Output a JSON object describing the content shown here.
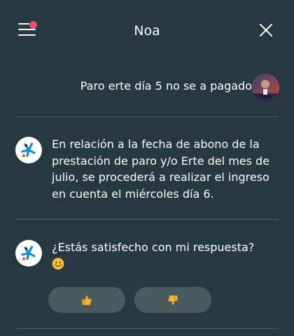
{
  "header": {
    "title": "Noa"
  },
  "conversation": {
    "user_message": "Paro erte día 5 no se a pagado",
    "bot_messages": [
      "En relación a la fecha de abono de la prestación de paro y/o Erte del mes de julio, se procederá a realizar el ingreso en cuenta el miércoles día 6.",
      "¿Estás satisfecho con mi respuesta?"
    ]
  },
  "colors": {
    "background": "#263940",
    "notification_dot": "#ee4d64",
    "feedback_button": "#4a5b5f",
    "brand_star": "#0d8fd1",
    "brand_accent": "#f06a3b"
  },
  "icons": {
    "menu": "hamburger-menu-icon",
    "close": "close-icon",
    "user_avatar": "user-avatar",
    "bot_avatar": "caixabank-star-logo",
    "emoji": "smiling-face-emoji",
    "thumbs_up": "thumbs-up-icon",
    "thumbs_down": "thumbs-down-icon"
  }
}
